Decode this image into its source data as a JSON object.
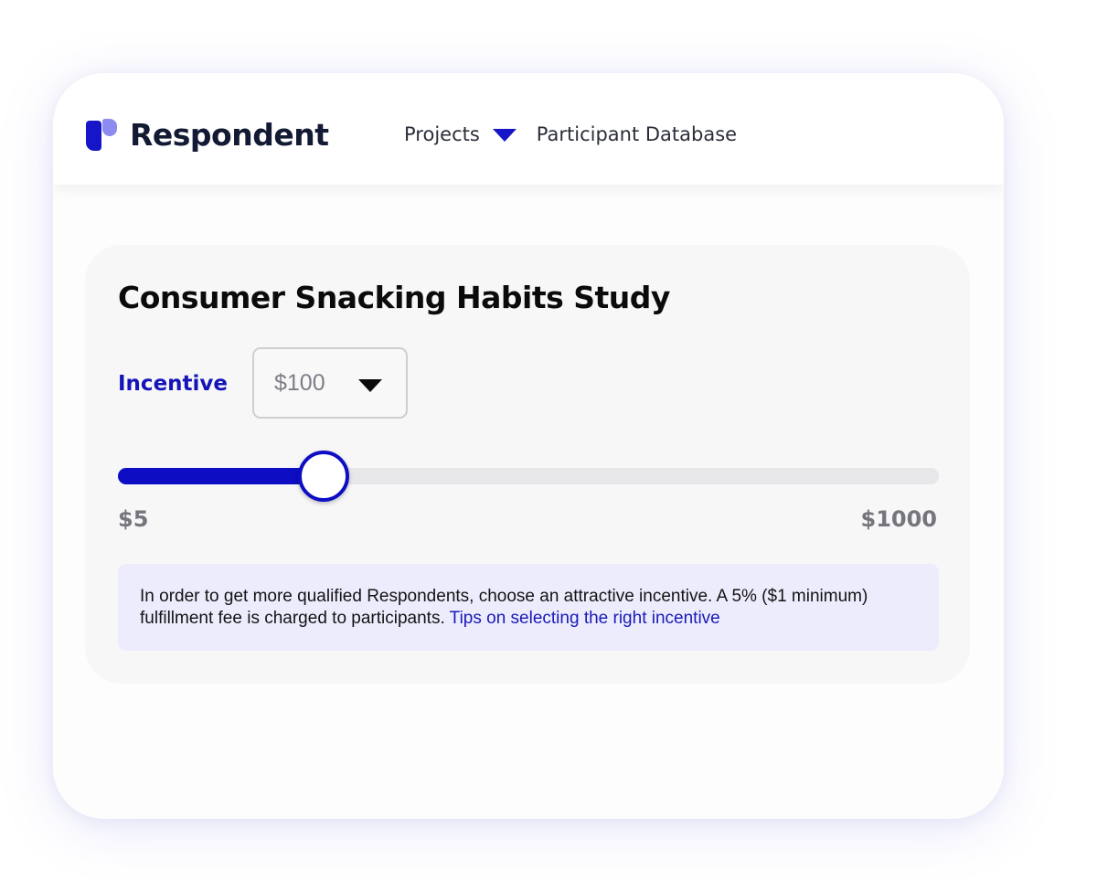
{
  "brand": {
    "name": "Respondent",
    "logo_icon": "respondent-logo-mark",
    "colors": {
      "primary": "#0d0dc4",
      "logo_light": "#8b8bf0",
      "info_background": "#ececfd"
    }
  },
  "nav": {
    "projects_label": "Projects",
    "projects_caret_icon": "caret-down-icon",
    "participant_database_label": "Participant Database"
  },
  "study": {
    "title": "Consumer Snacking Habits Study"
  },
  "incentive": {
    "label": "Incentive",
    "selected_value": "$100",
    "dropdown_icon": "caret-down-icon",
    "slider": {
      "min_label": "$5",
      "max_label": "$1000",
      "fill_fraction": 0.25
    }
  },
  "info": {
    "text": "In order to get more qualified Respondents, choose an attractive incentive. A 5% ($1 minimum) fulfillment fee is charged to participants.",
    "link_text": "Tips on selecting the right incentive"
  }
}
